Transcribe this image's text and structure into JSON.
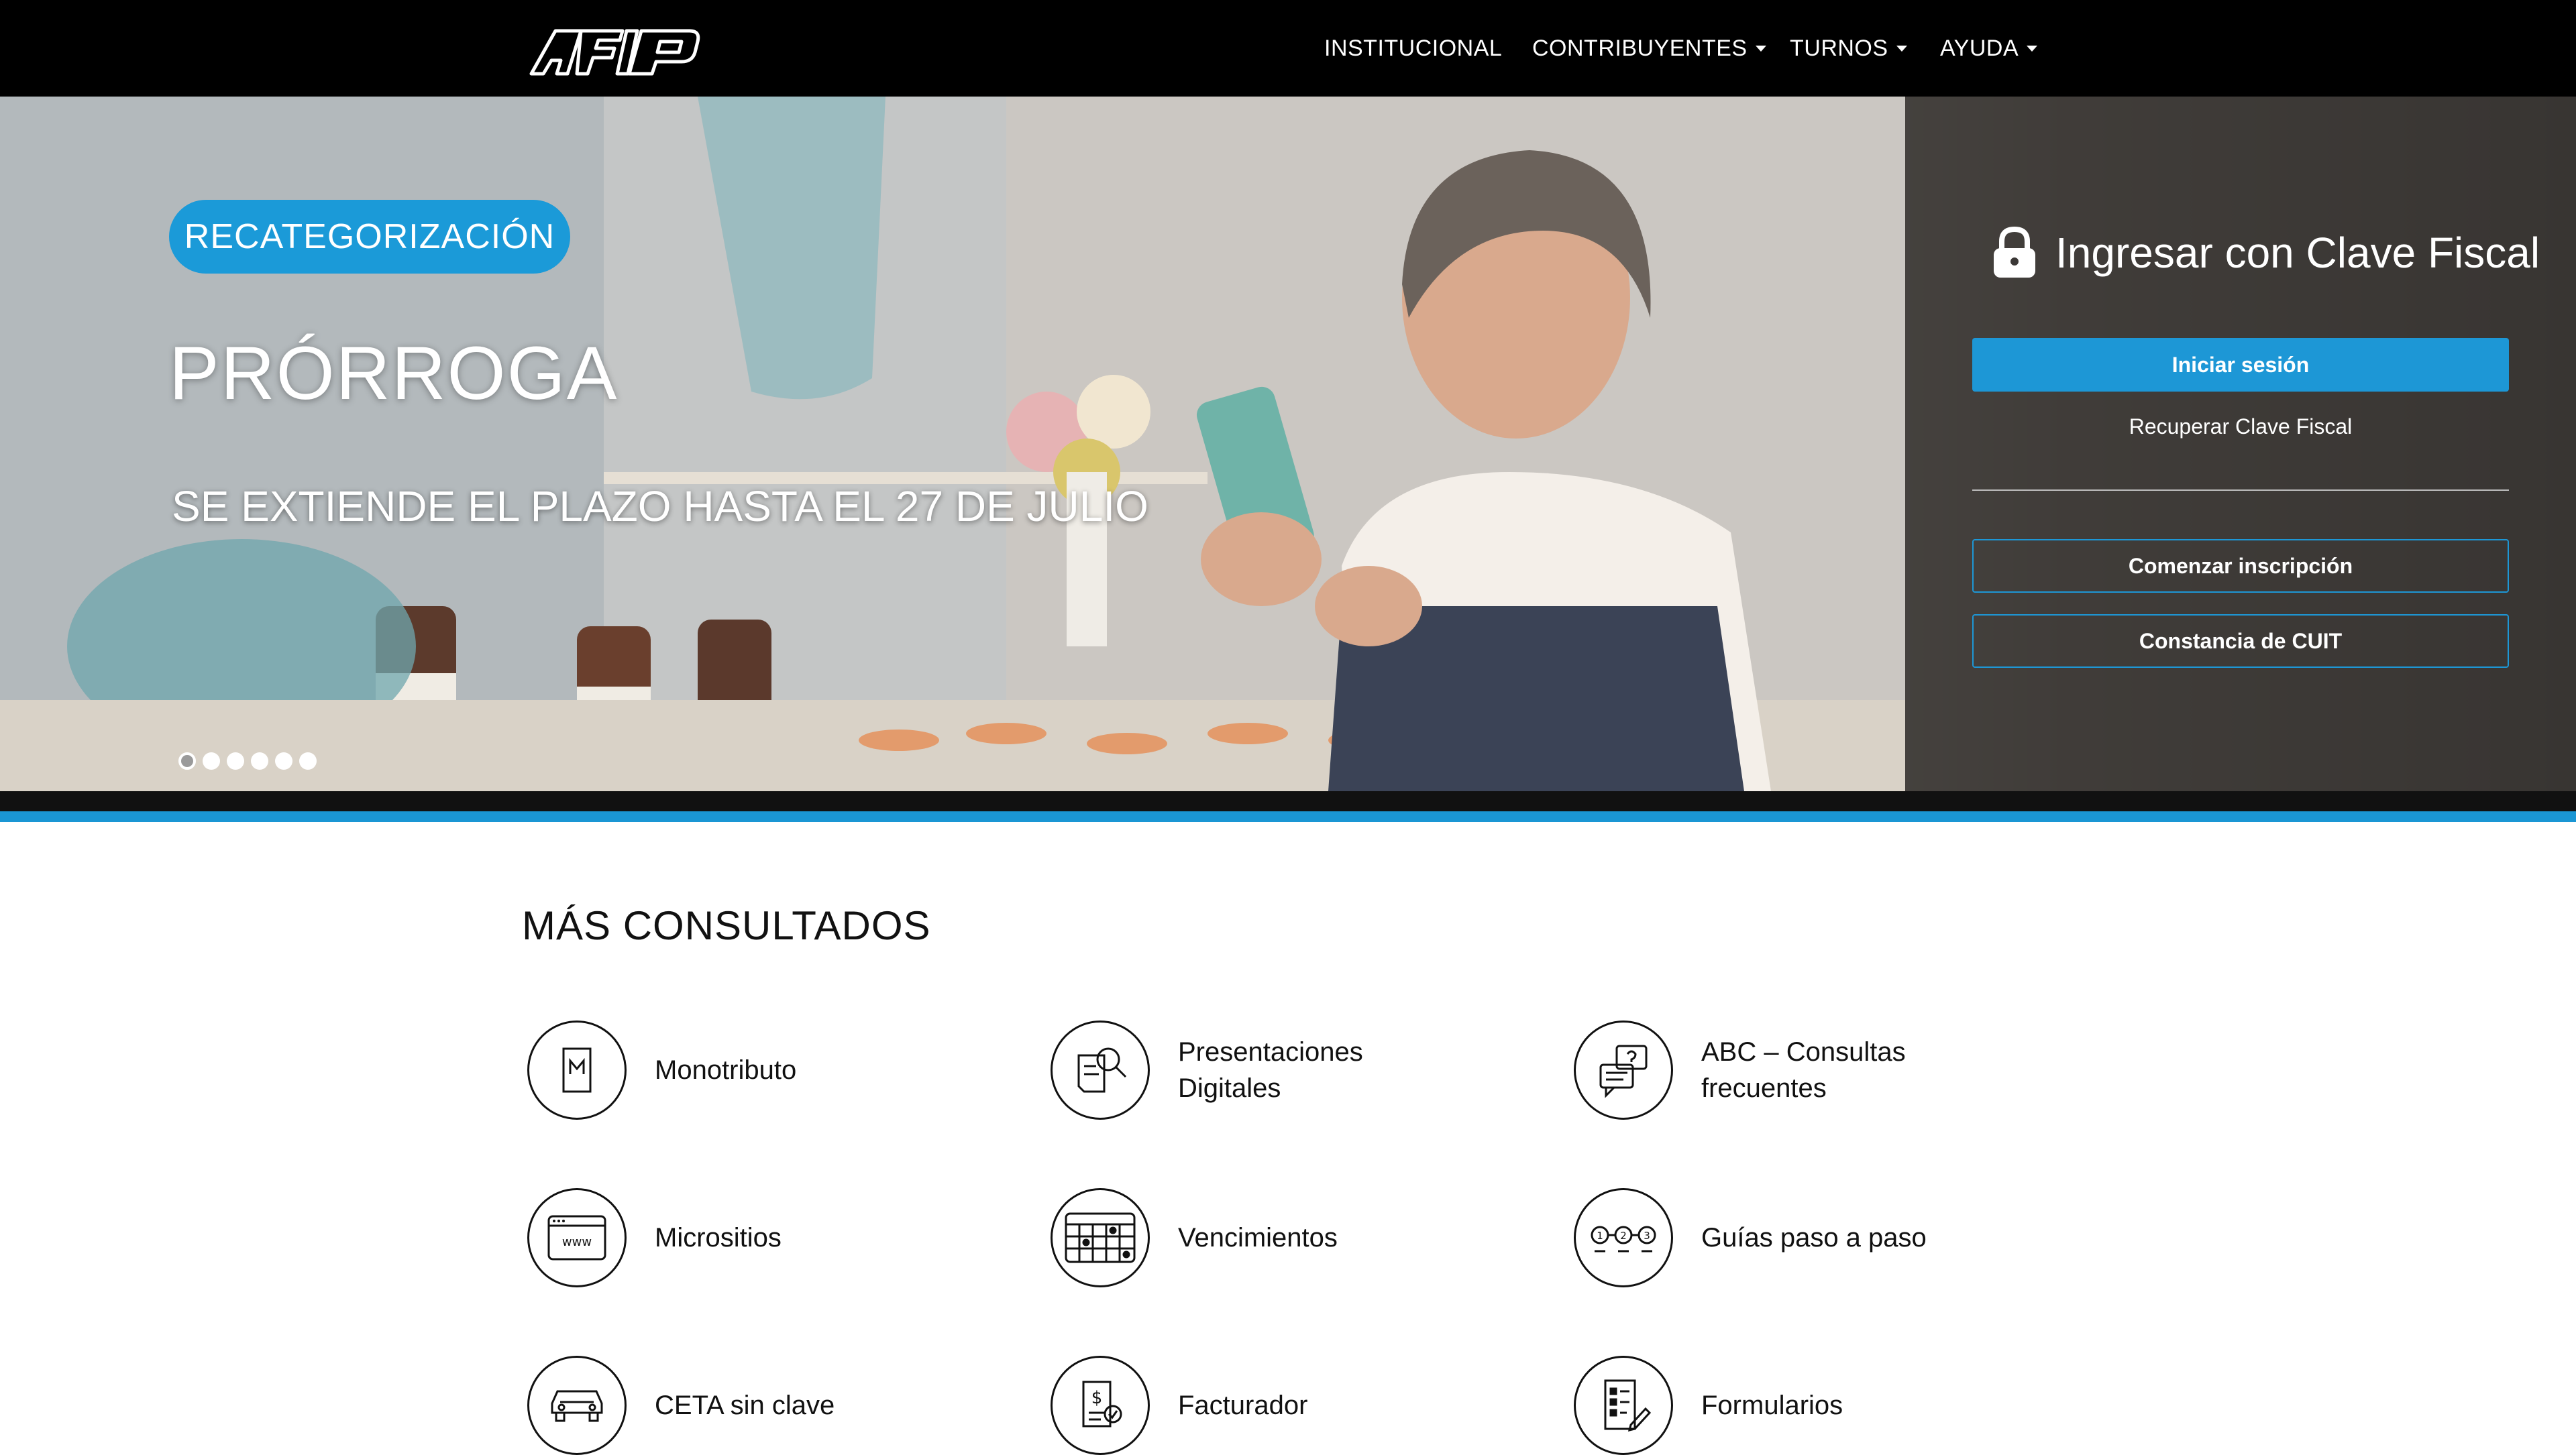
{
  "header": {
    "logo_text": "AFIP",
    "nav": [
      {
        "label": "INSTITUCIONAL",
        "dropdown": false
      },
      {
        "label": "CONTRIBUYENTES",
        "dropdown": true
      },
      {
        "label": "TURNOS",
        "dropdown": true
      },
      {
        "label": "AYUDA",
        "dropdown": true
      }
    ]
  },
  "hero": {
    "badge": "RECATEGORIZACIÓN",
    "headline": "PRÓRROGA",
    "subline": "SE EXTIENDE EL PLAZO HASTA EL 27 DE JULIO",
    "slides_total": 6,
    "active_slide": 1
  },
  "login": {
    "title": "Ingresar con Clave Fiscal",
    "login_button": "Iniciar sesión",
    "recover_link": "Recuperar Clave Fiscal",
    "register_button": "Comenzar inscripción",
    "cuit_button": "Constancia de CUIT"
  },
  "most_consulted": {
    "title": "MÁS CONSULTADOS",
    "items": [
      {
        "label": "Monotributo",
        "icon": "monotributo-icon"
      },
      {
        "label": "Presentaciones Digitales",
        "icon": "document-search-icon"
      },
      {
        "label": "ABC – Consultas frecuentes",
        "icon": "faq-chat-icon"
      },
      {
        "label": "Micrositios",
        "icon": "www-browser-icon"
      },
      {
        "label": "Vencimientos",
        "icon": "calendar-icon"
      },
      {
        "label": "Guías paso a paso",
        "icon": "steps-icon"
      },
      {
        "label": "CETA sin clave",
        "icon": "car-icon"
      },
      {
        "label": "Facturador",
        "icon": "invoice-icon"
      },
      {
        "label": "Formularios",
        "icon": "form-icon"
      }
    ]
  },
  "colors": {
    "brand_blue": "#1d97d6",
    "nav_background": "#000000"
  }
}
